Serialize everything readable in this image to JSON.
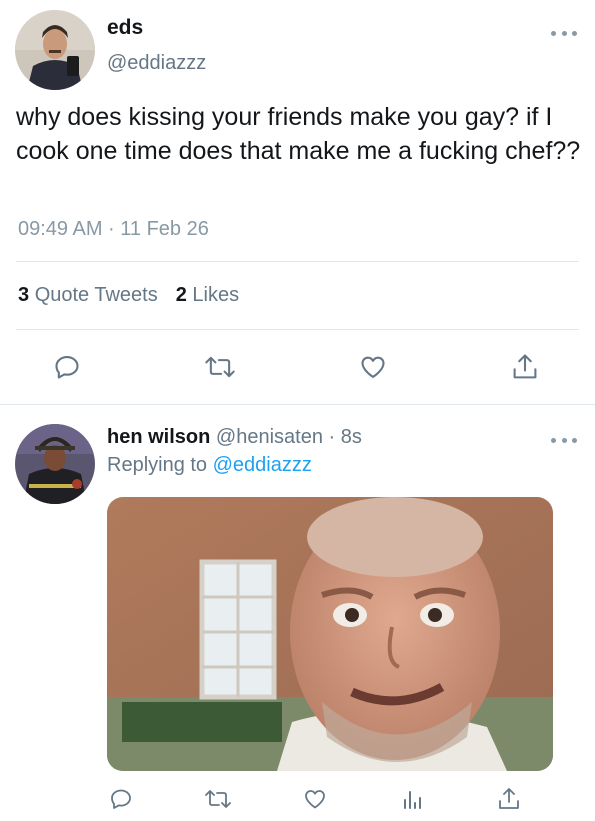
{
  "tweet": {
    "author_name": "eds",
    "author_handle": "@eddiazzz",
    "text": "why does kissing your friends make you gay? if I cook one time does that make me a fucking chef??",
    "timestamp": "09:49 AM · 11 Feb 26",
    "quote_count": "3",
    "quote_label": "Quote Tweets",
    "like_count": "2",
    "like_label": "Likes"
  },
  "actions": [
    "reply-icon",
    "retweet-icon",
    "heart-icon",
    "share-icon"
  ],
  "reply": {
    "author_name": "hen wilson",
    "author_handle": "@henisaten",
    "time": "· 8s",
    "replying_prefix": "Replying to",
    "replying_to": "@eddiazzz",
    "actions": [
      "reply-icon",
      "retweet-icon",
      "heart-icon",
      "analytics-icon",
      "share-icon"
    ]
  },
  "colors": {
    "icon": "#657786",
    "link": "#1da1f2",
    "divider": "#e1e8ed"
  }
}
